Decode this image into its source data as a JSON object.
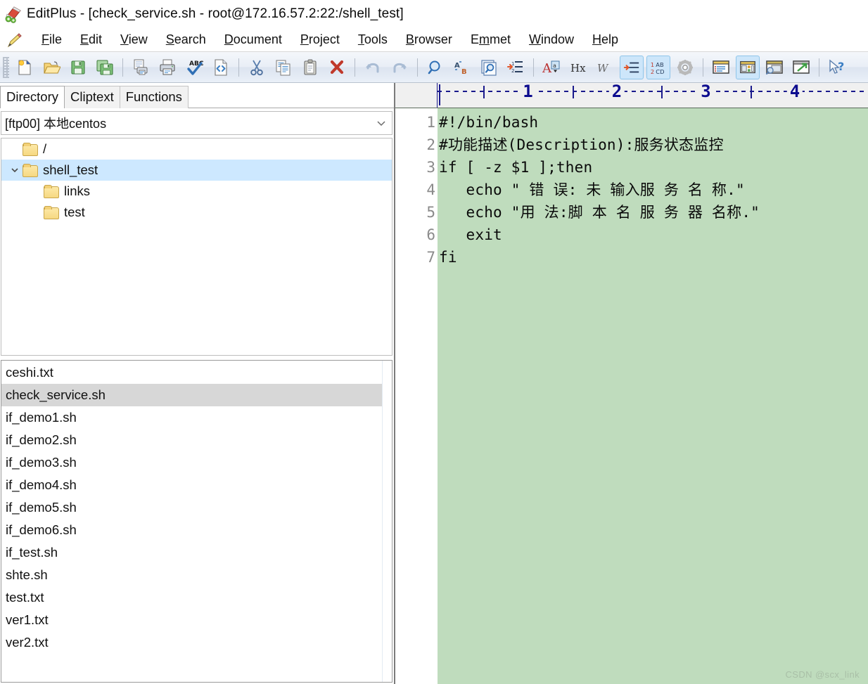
{
  "window": {
    "icon": "editplus-app-icon",
    "title": "EditPlus - [check_service.sh - root@172.16.57.2:22:/shell_test]"
  },
  "menubar": {
    "icon": "pencil-icon",
    "items": [
      {
        "label": "File",
        "mnemonic": "F"
      },
      {
        "label": "Edit",
        "mnemonic": "E"
      },
      {
        "label": "View",
        "mnemonic": "V"
      },
      {
        "label": "Search",
        "mnemonic": "S"
      },
      {
        "label": "Document",
        "mnemonic": "D"
      },
      {
        "label": "Project",
        "mnemonic": "P"
      },
      {
        "label": "Tools",
        "mnemonic": "T"
      },
      {
        "label": "Browser",
        "mnemonic": "B"
      },
      {
        "label": "Emmet",
        "mnemonic": "m"
      },
      {
        "label": "Window",
        "mnemonic": "W"
      },
      {
        "label": "Help",
        "mnemonic": "H"
      }
    ]
  },
  "toolbar": {
    "groups": [
      [
        "new-file-icon",
        "open-file-icon",
        "save-file-icon",
        "save-all-icon"
      ],
      [
        "print-preview-icon",
        "print-icon",
        "spell-check-icon",
        "view-in-browser-icon"
      ],
      [
        "cut-icon",
        "copy-icon",
        "paste-icon",
        "delete-icon"
      ],
      [
        "undo-icon",
        "redo-icon"
      ],
      [
        "find-icon",
        "replace-icon",
        "find-in-files-icon",
        "goto-line-icon"
      ],
      [
        "font-icon",
        "hex-viewer-icon",
        "word-wrap-icon",
        "indent-icon",
        "column-mode-icon",
        "preferences-icon"
      ],
      [
        "document-selector-icon",
        "directory-window-icon",
        "output-window-icon",
        "ftp-upload-icon"
      ],
      [
        "help-pointer-icon"
      ]
    ],
    "active": [
      "indent-icon",
      "column-mode-icon",
      "directory-window-icon"
    ]
  },
  "sidebar": {
    "tabs": [
      {
        "label": "Directory",
        "selected": true
      },
      {
        "label": "Cliptext",
        "selected": false
      },
      {
        "label": "Functions",
        "selected": false
      }
    ],
    "combo": {
      "value": "[ftp00] 本地centos",
      "arrow": "chevron-down-icon"
    },
    "tree": [
      {
        "label": "/",
        "indent": 1,
        "expander": "",
        "selected": false
      },
      {
        "label": "shell_test",
        "indent": 1,
        "expander": "v",
        "selected": true
      },
      {
        "label": "links",
        "indent": 2,
        "expander": "",
        "selected": false
      },
      {
        "label": "test",
        "indent": 2,
        "expander": "",
        "selected": false
      }
    ],
    "files": [
      {
        "name": "ceshi.txt",
        "selected": false
      },
      {
        "name": "check_service.sh",
        "selected": true
      },
      {
        "name": "if_demo1.sh",
        "selected": false
      },
      {
        "name": "if_demo2.sh",
        "selected": false
      },
      {
        "name": "if_demo3.sh",
        "selected": false
      },
      {
        "name": "if_demo4.sh",
        "selected": false
      },
      {
        "name": "if_demo5.sh",
        "selected": false
      },
      {
        "name": "if_demo6.sh",
        "selected": false
      },
      {
        "name": "if_test.sh",
        "selected": false
      },
      {
        "name": "shte.sh",
        "selected": false
      },
      {
        "name": "test.txt",
        "selected": false
      },
      {
        "name": "ver1.txt",
        "selected": false
      },
      {
        "name": "ver2.txt",
        "selected": false
      }
    ]
  },
  "editor": {
    "ruler": {
      "numbers": [
        "1",
        "2",
        "3",
        "4"
      ]
    },
    "lines": [
      {
        "no": "1",
        "fold": false,
        "text": "#!/bin/bash"
      },
      {
        "no": "2",
        "fold": false,
        "text": "#功能描述(Description):服务状态监控"
      },
      {
        "no": "3",
        "fold": true,
        "text": "if [ -z $1 ];then"
      },
      {
        "no": "4",
        "fold": false,
        "text": "   echo \" 错 误: 未 输入服 务 名 称.\""
      },
      {
        "no": "5",
        "fold": false,
        "text": "   echo \"用 法:脚 本 名 服 务 器 名称.\""
      },
      {
        "no": "6",
        "fold": false,
        "text": "   exit"
      },
      {
        "no": "7",
        "fold": false,
        "text": "fi"
      }
    ],
    "watermark": "CSDN @scx_link",
    "colors": {
      "background": "#bfdcbd",
      "gutter": "#ffffff",
      "ruler_ink": "#0d0d8f",
      "selection": "#cde8ff"
    }
  }
}
